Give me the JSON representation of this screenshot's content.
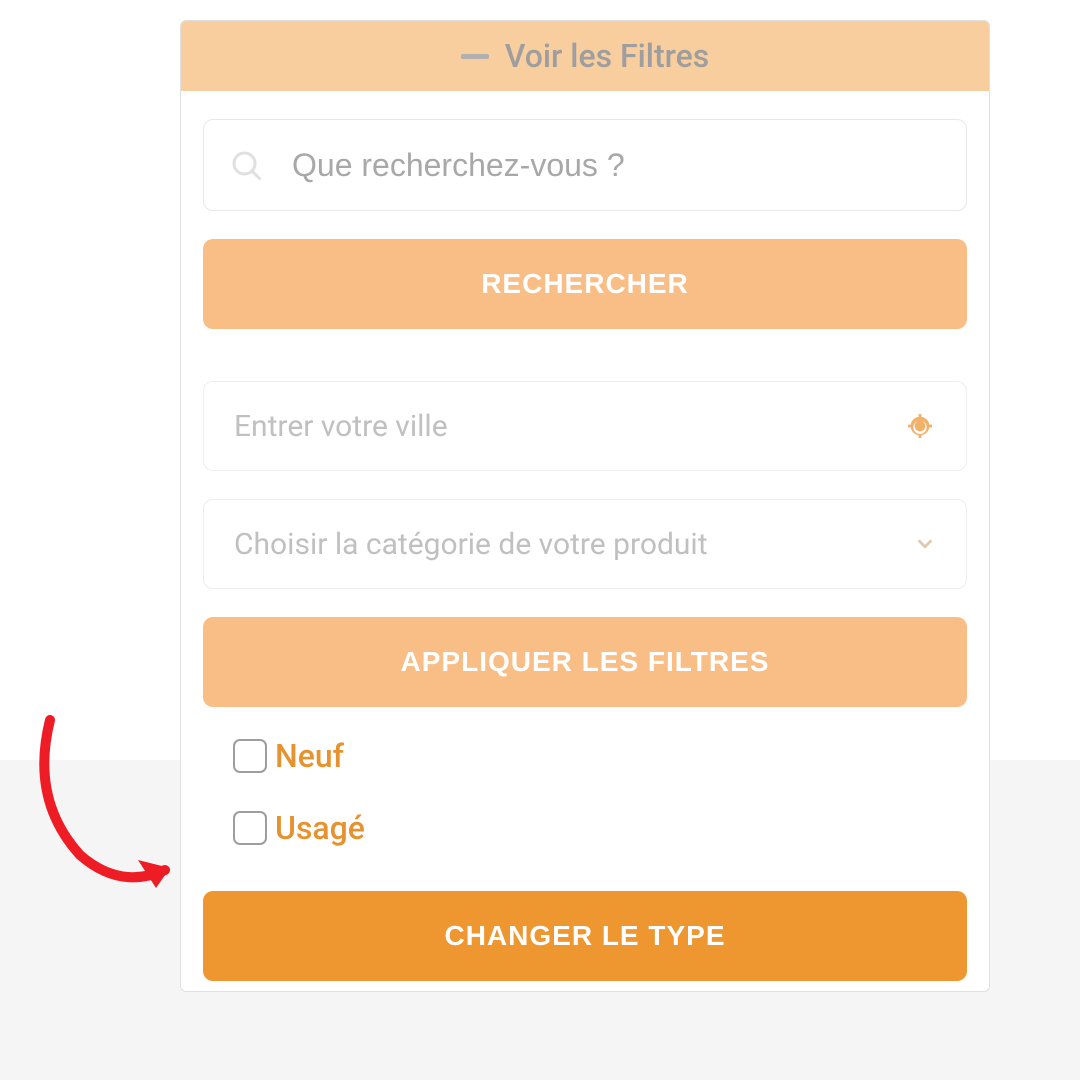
{
  "header": {
    "title": "Voir les Filtres"
  },
  "search": {
    "placeholder": "Que recherchez-vous ?",
    "button": "RECHERCHER"
  },
  "city": {
    "placeholder": "Entrer votre ville"
  },
  "category": {
    "placeholder": "Choisir la catégorie de votre produit"
  },
  "applyFilters": "APPLIQUER LES FILTRES",
  "conditions": [
    {
      "label": "Neuf"
    },
    {
      "label": "Usagé"
    }
  ],
  "changeType": "CHANGER LE TYPE"
}
